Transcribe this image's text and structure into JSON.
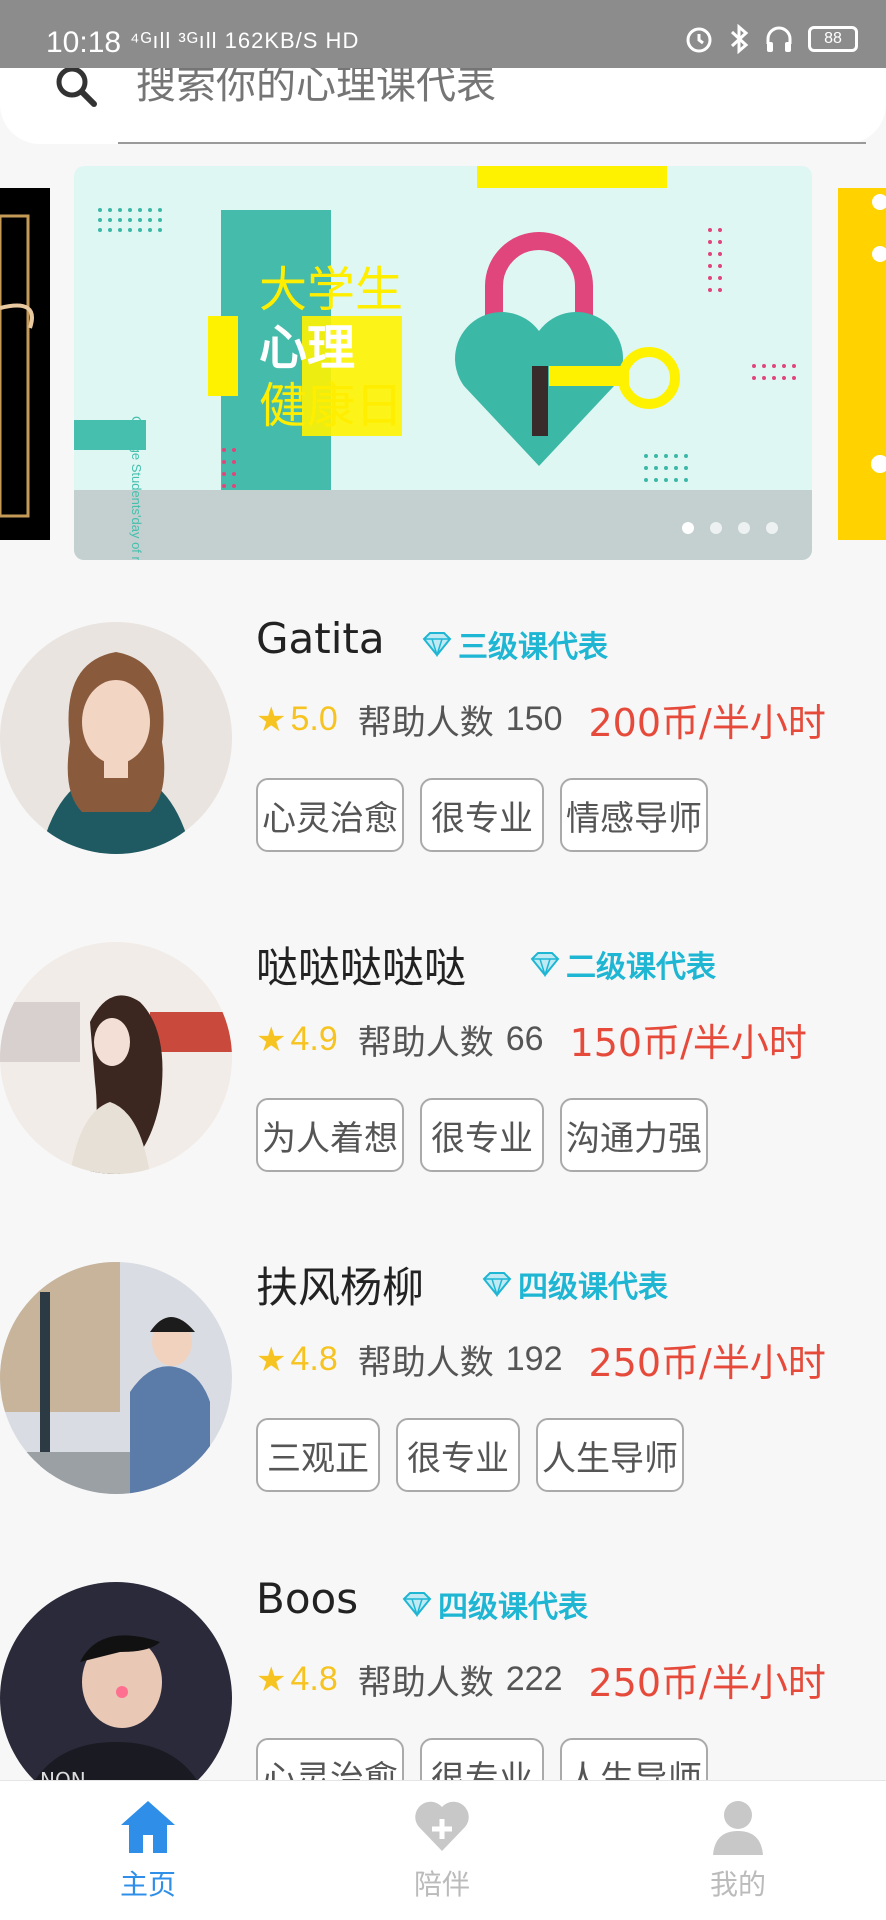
{
  "status_bar": {
    "time": "10:18",
    "network": "⁴ᴳıll ³ᴳıll 162KB/S HD",
    "battery": "88"
  },
  "search": {
    "placeholder": "搜索你的心理课代表"
  },
  "banner": {
    "line1": "大学生",
    "line2": "心理",
    "line3": "健康日",
    "subtitle": "College Students'day of mental health",
    "page_count": 4,
    "active_page": 1
  },
  "representatives": [
    {
      "name": "Gatita",
      "level": "三级课代表",
      "rating": "5.0",
      "helped_label": "帮助人数",
      "helped_count": "150",
      "price": "200币/半小时",
      "tags": [
        "心灵治愈",
        "很专业",
        "情感导师"
      ]
    },
    {
      "name": "哒哒哒哒哒",
      "level": "二级课代表",
      "rating": "4.9",
      "helped_label": "帮助人数",
      "helped_count": "66",
      "price": "150币/半小时",
      "tags": [
        "为人着想",
        "很专业",
        "沟通力强"
      ]
    },
    {
      "name": "扶风杨柳",
      "level": "四级课代表",
      "rating": "4.8",
      "helped_label": "帮助人数",
      "helped_count": "192",
      "price": "250币/半小时",
      "tags": [
        "三观正",
        "很专业",
        "人生导师"
      ]
    },
    {
      "name": "Boos",
      "level": "四级课代表",
      "rating": "4.8",
      "helped_label": "帮助人数",
      "helped_count": "222",
      "price": "250币/半小时",
      "tags": [
        "心灵治愈",
        "很专业",
        "人生导师"
      ]
    }
  ],
  "tabbar": {
    "home": "主页",
    "companion": "陪伴",
    "mine": "我的"
  },
  "colors": {
    "accent": "#2f8fe8",
    "level": "#1fb6d3",
    "price": "#e64a3b",
    "star": "#f7c321"
  }
}
